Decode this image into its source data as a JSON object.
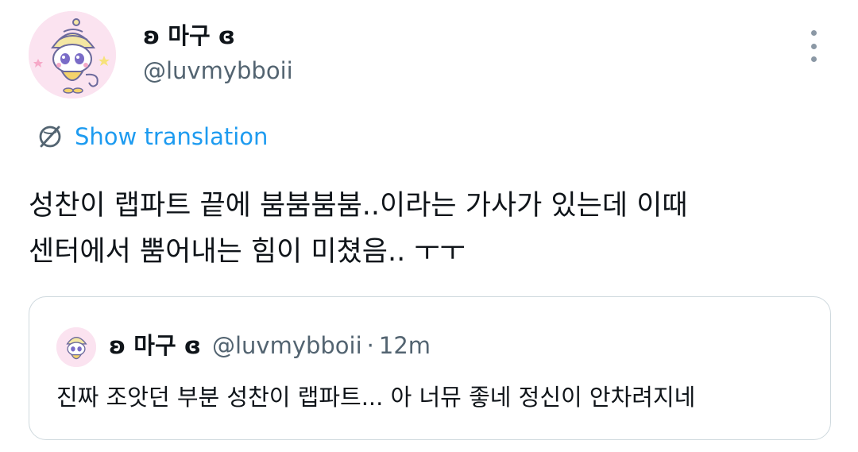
{
  "tweet": {
    "display_name": "ʚ 마구 ɞ",
    "handle": "@luvmybboii",
    "translate_label": "Show translation",
    "text_line1": "성찬이 랩파트 끝에 붐붐붐붐..이라는 가사가 있는데 이때",
    "text_line2": "센터에서 뿜어내는 힘이 미쳤음.. ㅜㅜ"
  },
  "quote": {
    "display_name": "ʚ 마구 ɞ",
    "handle": "@luvmybboii",
    "separator": "·",
    "time": "12m",
    "text": "진짜 조앗던 부분 성찬이 랩파트... 아 너뮤 좋네 정신이 안차려지네"
  },
  "colors": {
    "link_blue": "#1d9bf0",
    "secondary_text": "#536471",
    "border": "#cfd9de",
    "avatar_bg": "#fbe3f0"
  },
  "icons": {
    "more": "more-vertical-icon",
    "translate": "translate-globe-icon"
  }
}
